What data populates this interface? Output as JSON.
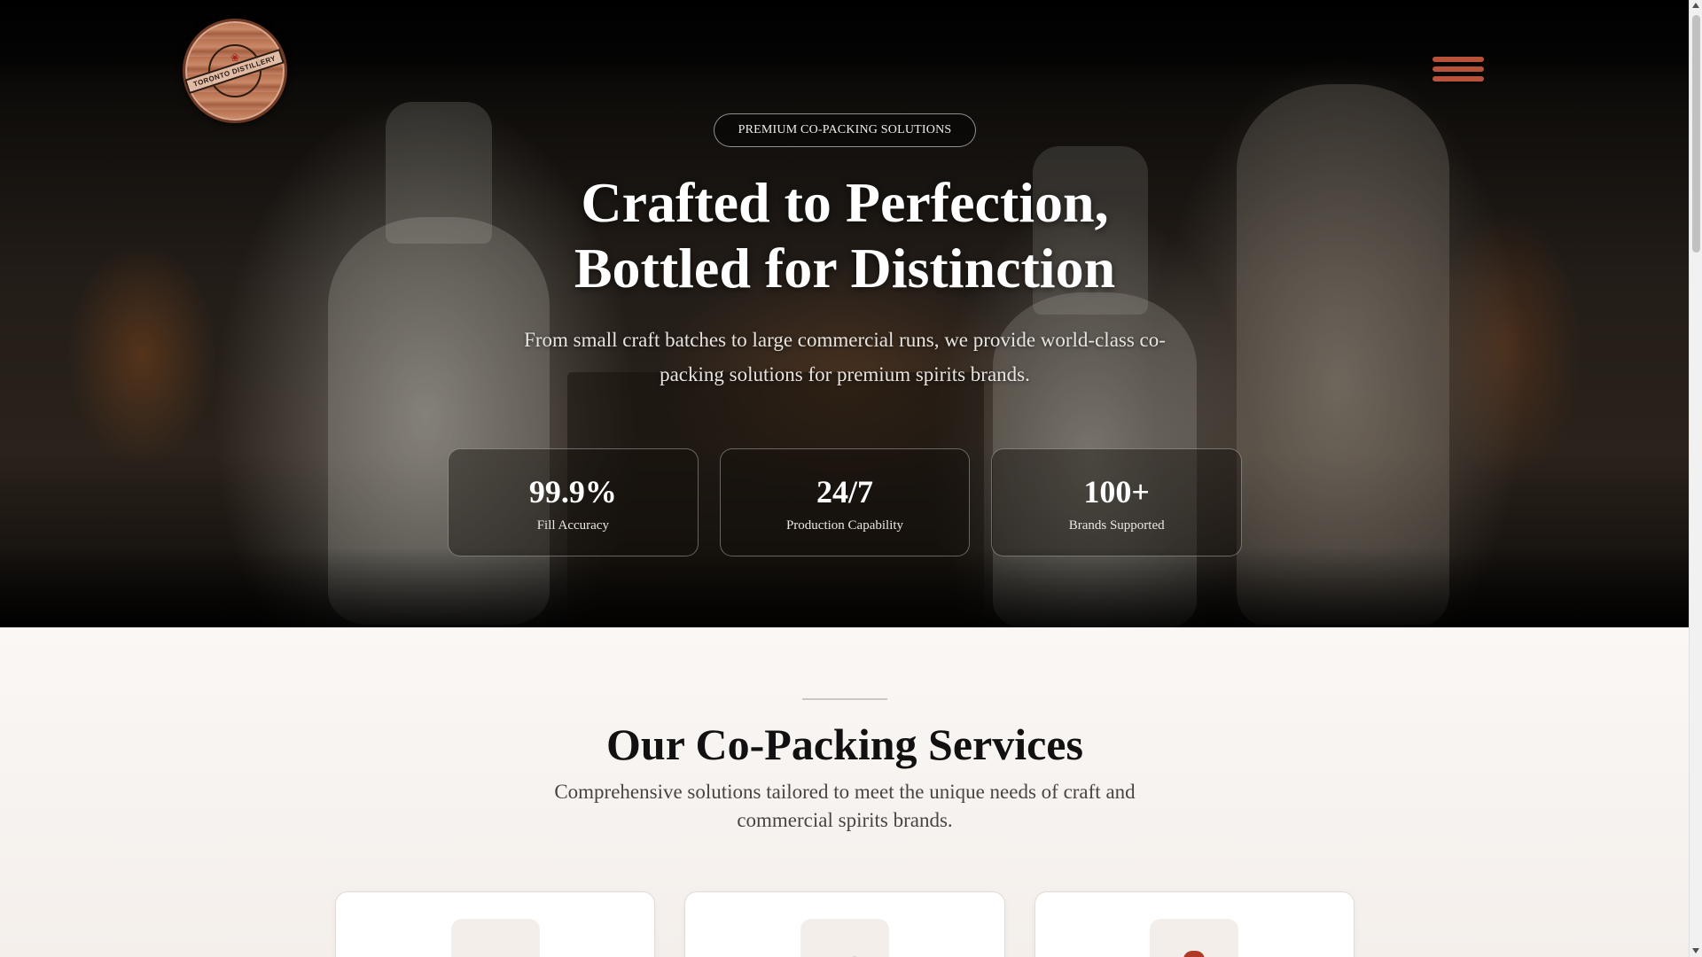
{
  "brand": {
    "logo_text": "TORONTO DISTILLERY",
    "logo_icon": "maple-leaf-icon"
  },
  "nav": {
    "menu_icon": "hamburger-menu-icon"
  },
  "hero": {
    "badge": "PREMIUM CO-PACKING SOLUTIONS",
    "title_line1": "Crafted to Perfection,",
    "title_line2": "Bottled for Distinction",
    "subtitle": "From small craft batches to large commercial runs, we provide world-class co-packing solutions for premium spirits brands.",
    "stats": [
      {
        "value": "99.9%",
        "label": "Fill Accuracy"
      },
      {
        "value": "24/7",
        "label": "Production Capability"
      },
      {
        "value": "100+",
        "label": "Brands Supported"
      }
    ]
  },
  "services": {
    "title": "Our Co-Packing Services",
    "subtitle": "Comprehensive solutions tailored to meet the unique needs of craft and commercial spirits brands.",
    "cards": [
      {
        "icon": "glass-icon"
      },
      {
        "icon": "price-tag-icon"
      },
      {
        "icon": "gift-box-icon"
      }
    ]
  },
  "colors": {
    "accent": "#b8533a",
    "hero_text": "#ffffff",
    "section_bg": "#f6f2ef",
    "heading": "#121010"
  }
}
